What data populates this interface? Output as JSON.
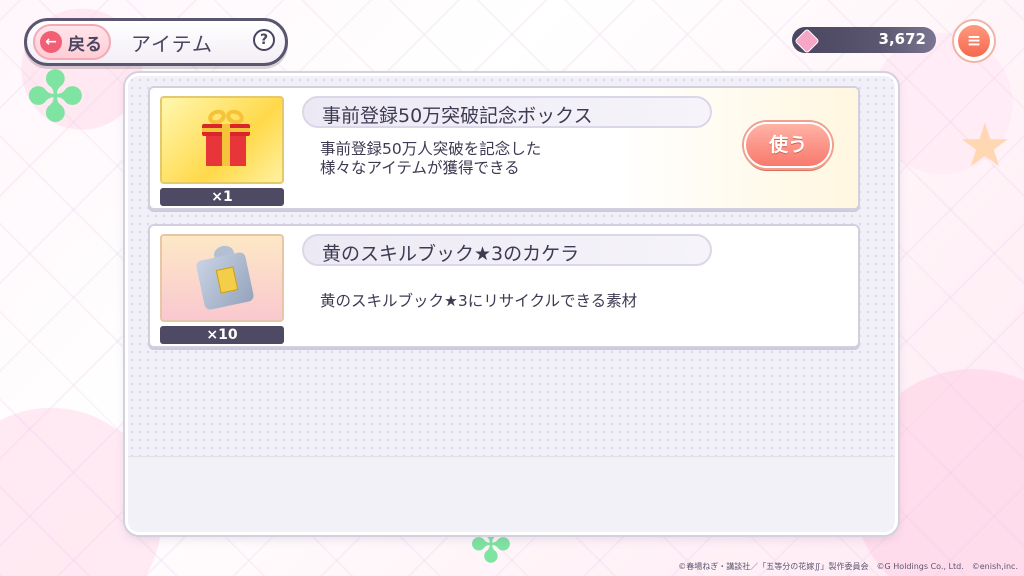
{
  "header": {
    "back_label": "戻る",
    "back_arrow": "←",
    "title": "アイテム",
    "help_glyph": "?"
  },
  "currency": {
    "value": "3,672",
    "icon": "gem-icon",
    "color": "#f7a6c8"
  },
  "menu": {
    "glyph": "≡",
    "icon": "menu-icon"
  },
  "items": [
    {
      "name": "事前登録50万突破記念ボックス",
      "description": "事前登録50万人突破を記念した\n様々なアイテムが獲得できる",
      "count": "×1",
      "icon": "gift-box-icon",
      "use_label": "使う"
    },
    {
      "name": "黄のスキルブック★3のカケラ",
      "description": "黄のスキルブック★3にリサイクルできる素材",
      "count": "×10",
      "icon": "puzzle-piece-icon"
    }
  ],
  "copyright": "©春場ねぎ・講談社／「五等分の花嫁∬」製作委員会　©G Holdings Co., Ltd.　©enish,inc.",
  "colors": {
    "accent": "#f8796c",
    "dark": "#4a4560",
    "panel": "#f1eff7"
  }
}
